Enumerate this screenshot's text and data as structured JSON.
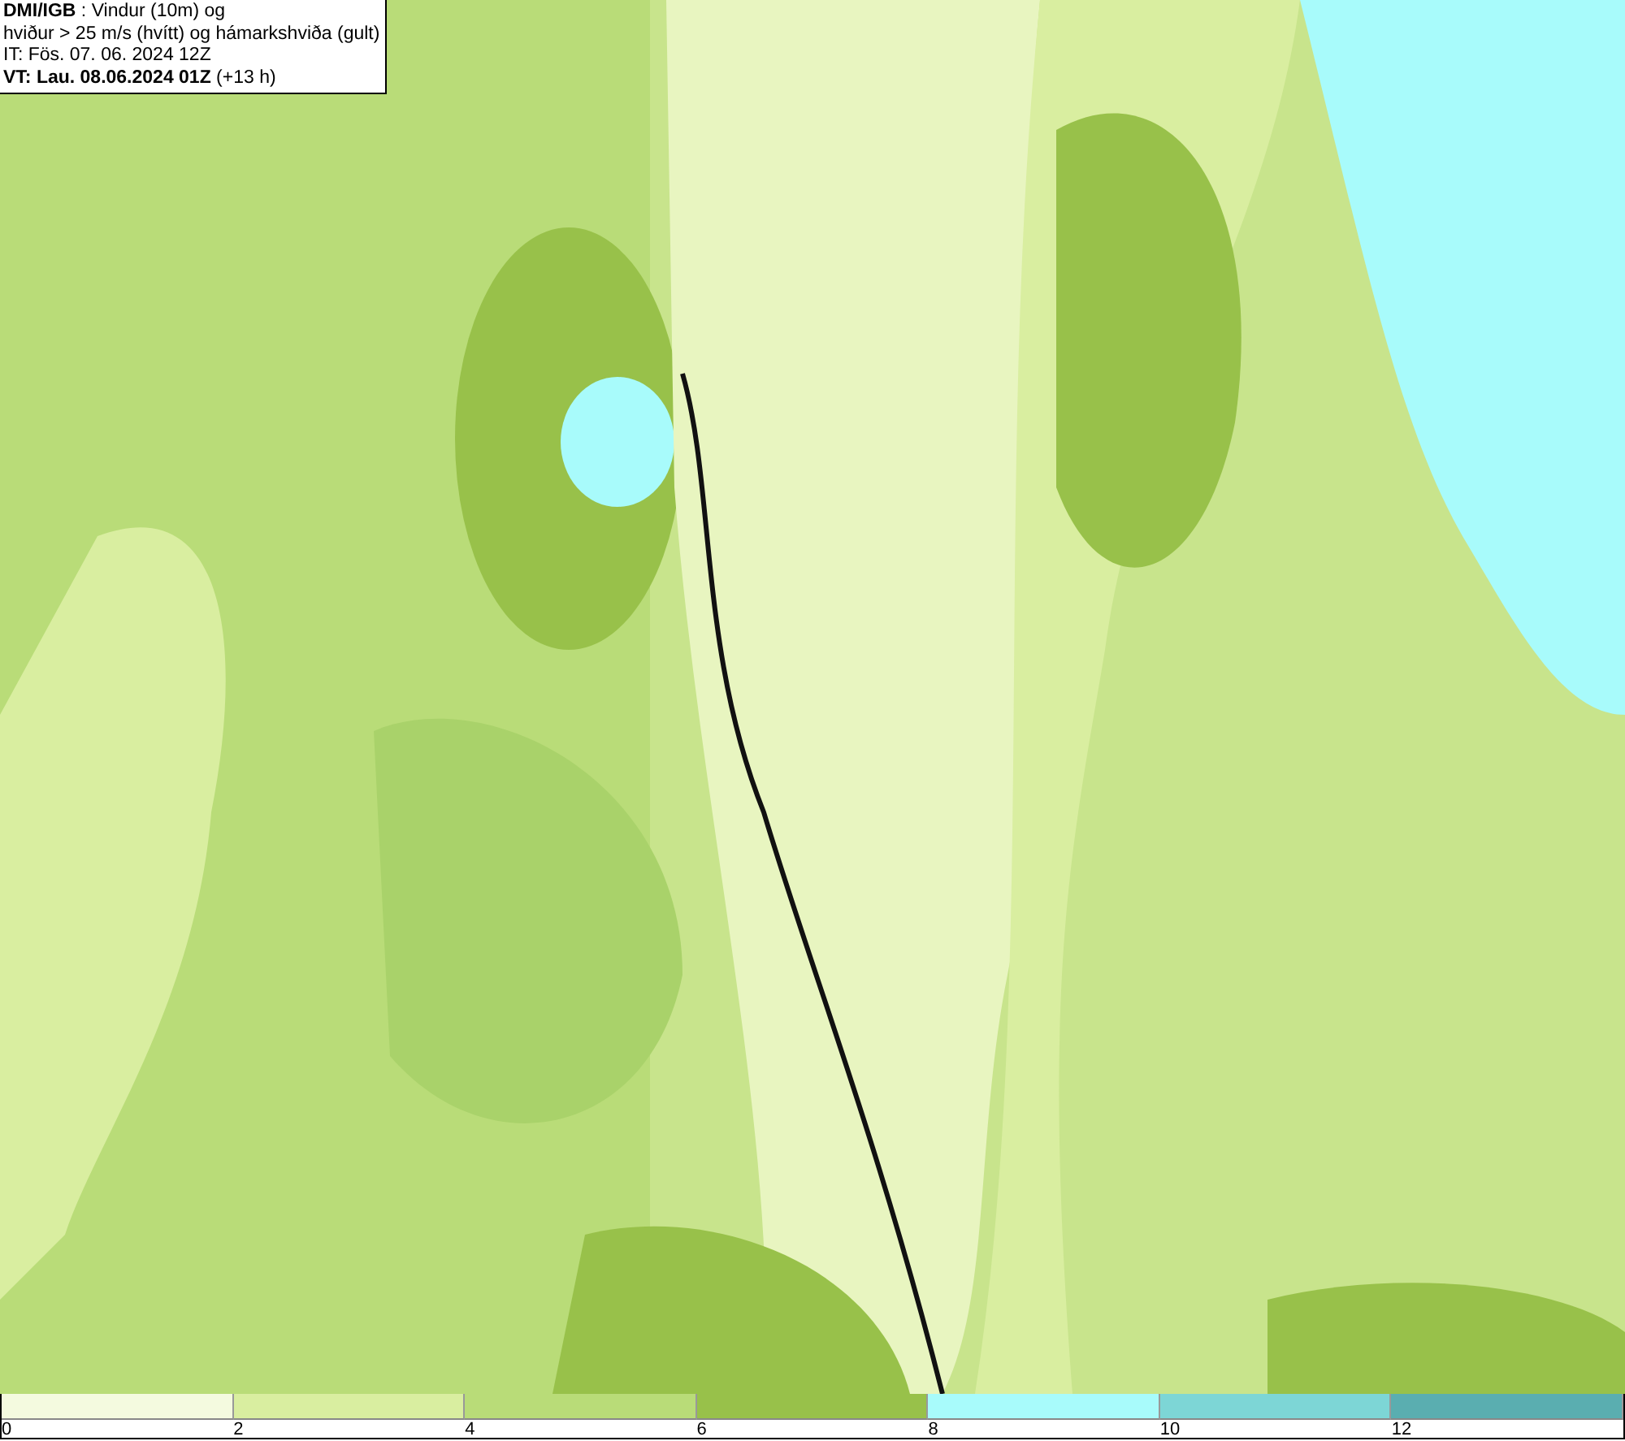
{
  "header": {
    "lines": [
      "**DMI/IGB** : Vindur (10m) og",
      "hviður > 25 m/s (hvítt) og hámarkshviða (gult)",
      "IT: Fös. 07. 06. 2024 12Z",
      "**VT: Lau. 08.06.2024 01Z** (+13 h)"
    ]
  },
  "legend": {
    "bins": [
      {
        "color": "#f4fadf"
      },
      {
        "color": "#d9eea0"
      },
      {
        "color": "#b9dc78"
      },
      {
        "color": "#98c14a"
      },
      {
        "color": "#a8fbfb"
      },
      {
        "color": "#7dd6d6"
      },
      {
        "color": "#5aaeb0"
      }
    ],
    "ticks": [
      "0",
      "2",
      "4",
      "6",
      "8",
      "10",
      "12"
    ]
  }
}
